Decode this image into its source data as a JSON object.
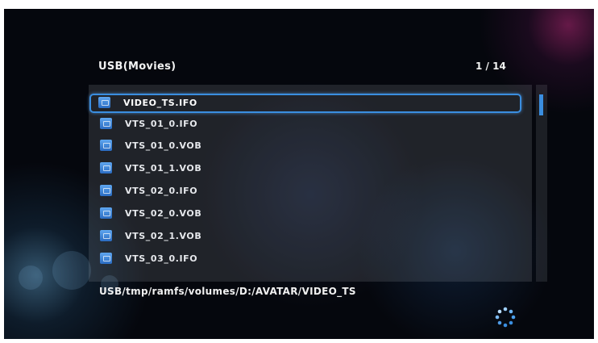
{
  "header": {
    "title": "USB(Movies)",
    "page_indicator": "1 / 14"
  },
  "files": [
    {
      "name": "VIDEO_TS.IFO",
      "selected": true
    },
    {
      "name": "VTS_01_0.IFO",
      "selected": false
    },
    {
      "name": "VTS_01_0.VOB",
      "selected": false
    },
    {
      "name": "VTS_01_1.VOB",
      "selected": false
    },
    {
      "name": "VTS_02_0.IFO",
      "selected": false
    },
    {
      "name": "VTS_02_0.VOB",
      "selected": false
    },
    {
      "name": "VTS_02_1.VOB",
      "selected": false
    },
    {
      "name": "VTS_03_0.IFO",
      "selected": false
    }
  ],
  "footer": {
    "path": "USB/tmp/ramfs/volumes/D:/AVATAR/VIDEO_TS"
  },
  "icons": {
    "file": "video-file-icon",
    "busy": "loading-spinner-icon"
  },
  "colors": {
    "accent": "#3a8ee0",
    "background": "#05070d",
    "text": "#f2f2f2"
  }
}
